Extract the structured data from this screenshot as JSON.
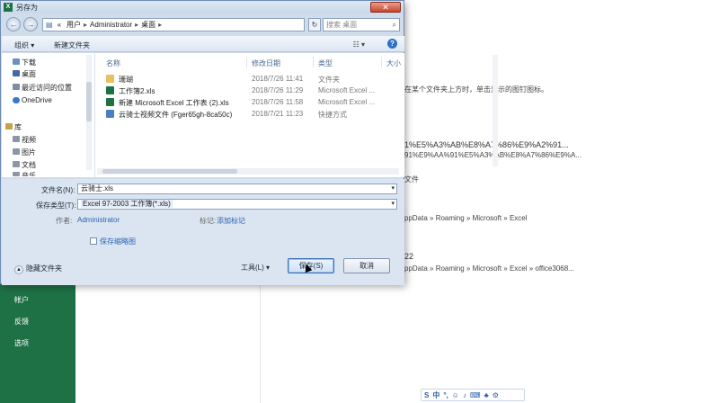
{
  "dialog": {
    "title": "另存为",
    "close_label": "✕",
    "address": {
      "crumbs": [
        "«",
        "用户",
        "Administrator",
        "桌面"
      ],
      "search_placeholder": "搜索 桌面"
    },
    "toolbar": {
      "organize": "组织 ▾",
      "new_folder": "新建文件夹",
      "views": "☷ ▾",
      "help": "?"
    },
    "nav_items": [
      {
        "label": "下载",
        "color": "#6a8fc4"
      },
      {
        "label": "桌面",
        "color": "#3f6ca8"
      },
      {
        "label": "最近访问的位置",
        "color": "#7c8da6"
      },
      {
        "label": "OneDrive",
        "color": "#3a78cc"
      },
      {
        "label": "库",
        "color": "#c7a24a"
      },
      {
        "label": "视频",
        "color": "#8b96a8"
      },
      {
        "label": "图片",
        "color": "#8b96a8"
      },
      {
        "label": "文档",
        "color": "#8b96a8"
      },
      {
        "label": "音乐",
        "color": "#8b96a8"
      }
    ],
    "columns": [
      "名称",
      "修改日期",
      "类型",
      "大小"
    ],
    "files": [
      {
        "name": "珊瑚",
        "date": "2018/7/26 11:41",
        "type": "文件夹",
        "icon": "folder-icon",
        "color": "#e8c15a"
      },
      {
        "name": "工作簿2.xls",
        "date": "2018/7/26 11:29",
        "type": "Microsoft Excel ...",
        "icon": "excel-icon",
        "color": "#1e7145"
      },
      {
        "name": "新建 Microsoft Excel 工作表 (2).xls",
        "date": "2018/7/26 11:58",
        "type": "Microsoft Excel ...",
        "icon": "excel-icon",
        "color": "#1e7145"
      },
      {
        "name": "云骑士视频文件 (Fger65gh-8ca50c)",
        "date": "2018/7/21 11:23",
        "type": "快捷方式",
        "icon": "shortcut-icon",
        "color": "#4a7fc1"
      }
    ],
    "filename_label": "文件名(N):",
    "filename_value": "云骑士.xls",
    "savetype_label": "保存类型(T):",
    "savetype_value": "Excel 97-2003 工作簿(*.xls)",
    "author_label": "作者:",
    "author_value": "Administrator",
    "tags_label": "标记:",
    "tags_value": "添加标记",
    "thumbnail_label": "保存缩略图",
    "hide_folders": "隐藏文件夹",
    "tools_label": "工具(L)",
    "save_label": "保存(S)",
    "cancel_label": "取消"
  },
  "backstage": {
    "nav": [
      "帐户",
      "反馈",
      "选项"
    ],
    "texts": [
      "在某个文件夹上方时，单击显示的图钉图标。",
      "1%E5%A3%AB%E8%A7%86%E9%A2%91...",
      "91%E9%AA%91%E5%A3%AB%E8%A7%86%E9%A...",
      "文件",
      "ppData » Roaming » Microsoft » Excel",
      "22",
      "ppData » Roaming » Microsoft » Excel » office3068..."
    ]
  },
  "ime": {
    "label": "中"
  }
}
